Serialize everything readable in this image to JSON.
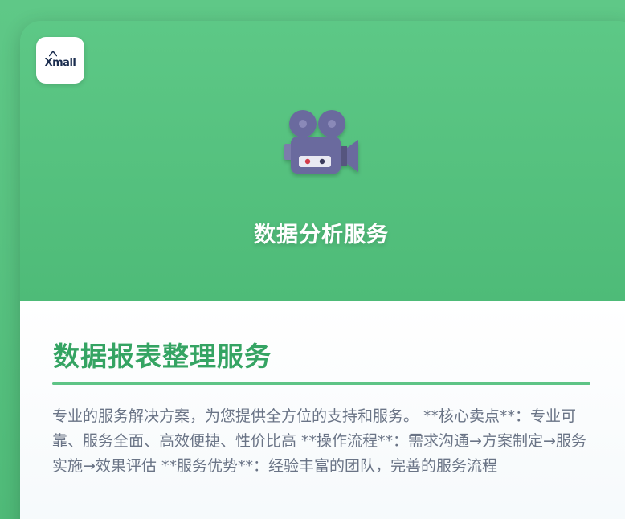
{
  "logo": {
    "text": "Xmall"
  },
  "hero": {
    "icon": "video-camera-icon",
    "title": "数据分析服务"
  },
  "content": {
    "title": "数据报表整理服务",
    "description": "专业的服务解决方案，为您提供全方位的支持和服务。 **核心卖点**：专业可靠、服务全面、高效便捷、性价比高 **操作流程**：需求沟通→方案制定→服务实施→效果评估 **服务优势**：经验丰富的团队，完善的服务流程"
  },
  "colors": {
    "hero_green": "#52bf7c",
    "title_green": "#35a463",
    "divider_green": "#5ec486",
    "camera_purple": "#6b6a9e",
    "body_text": "#6a7486"
  }
}
